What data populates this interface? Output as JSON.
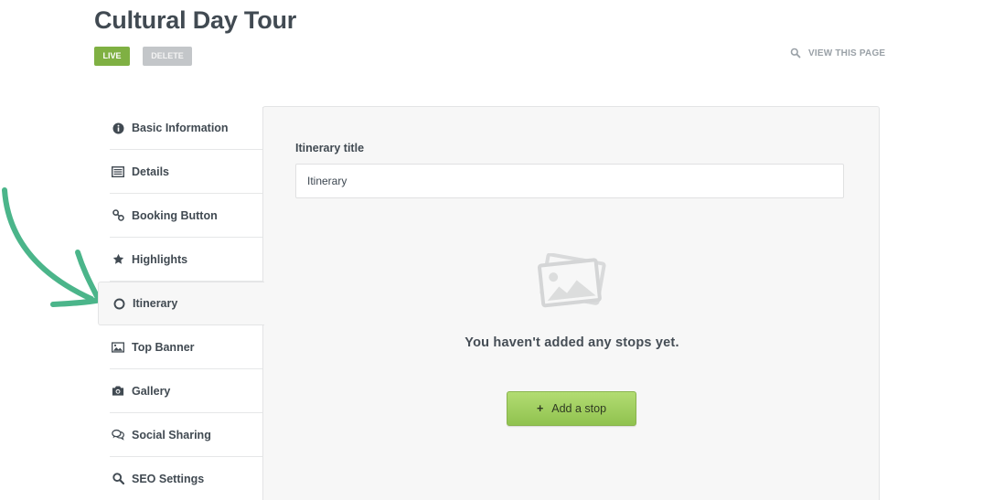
{
  "header": {
    "title": "Cultural Day Tour",
    "live_label": "LIVE",
    "delete_label": "DELETE",
    "view_link_label": "VIEW THIS PAGE"
  },
  "sidebar": {
    "items": [
      {
        "label": "Basic Information",
        "icon": "info-circle-icon"
      },
      {
        "label": "Details",
        "icon": "list-card-icon"
      },
      {
        "label": "Booking Button",
        "icon": "link-icon"
      },
      {
        "label": "Highlights",
        "icon": "star-icon"
      },
      {
        "label": "Itinerary",
        "icon": "circle-outline-icon",
        "active": true
      },
      {
        "label": "Top Banner",
        "icon": "image-icon"
      },
      {
        "label": "Gallery",
        "icon": "camera-icon"
      },
      {
        "label": "Social Sharing",
        "icon": "chat-bubbles-icon"
      },
      {
        "label": "SEO Settings",
        "icon": "search-icon"
      }
    ]
  },
  "itinerary": {
    "title_label": "Itinerary title",
    "title_value": "Itinerary",
    "empty_message": "You haven't added any stops yet.",
    "add_button_label": "Add a stop",
    "add_button_icon": "plus-icon"
  },
  "colors": {
    "live_badge": "#7fb043",
    "delete_badge": "#c3c6c9",
    "add_button": "#9fcf5e",
    "annotation_arrow": "#4bb58a"
  }
}
